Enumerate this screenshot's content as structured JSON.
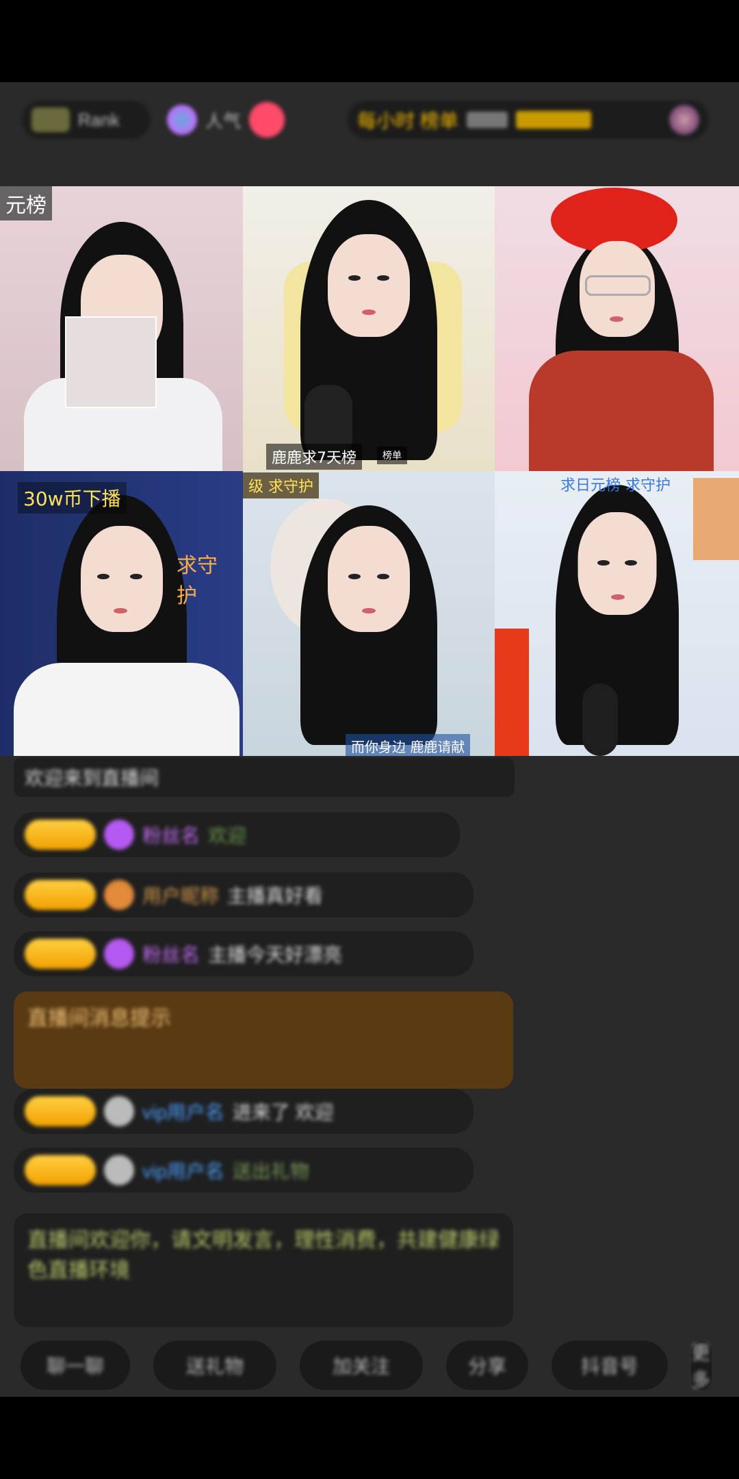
{
  "header": {
    "rank_pill": "Rank",
    "viewers_pill": "人气",
    "gold_text": "每小时 榜单",
    "avatar_label": "头像"
  },
  "tiles": [
    {
      "label": "元榜"
    },
    {
      "label": "鹿鹿求7天榜",
      "sub": "榜单"
    },
    {
      "label": ""
    },
    {
      "label": "30w币下播",
      "side": "求守护"
    },
    {
      "label": "级 求守护",
      "bottom": "而你身边 鹿鹿请献"
    },
    {
      "label": "求日元榜 求守护"
    }
  ],
  "chat": {
    "line0": "欢迎来到直播间",
    "lines": [
      {
        "name": "粉丝名",
        "text": "欢迎"
      },
      {
        "name": "用户昵称",
        "text": "主播真好看"
      },
      {
        "name": "粉丝名",
        "text": "主播今天好漂亮"
      },
      {
        "name": "vip用户名",
        "text": "进来了 欢迎"
      },
      {
        "name": "vip用户名",
        "text": "送出礼物"
      }
    ],
    "system_note": "直播间消息提示",
    "announcement": "直播间欢迎你，请文明发言，理性消费，共建健康绿色直播环境"
  },
  "bottom_buttons": [
    "聊一聊",
    "送礼物",
    "加关注",
    "分享",
    "抖音号",
    "更多"
  ],
  "colors": {
    "gold": "#f5b800",
    "purple": "#c46df5",
    "orange_name": "#d79a4a",
    "blue_name": "#4aa0ff",
    "green_text": "#b7c96a"
  }
}
